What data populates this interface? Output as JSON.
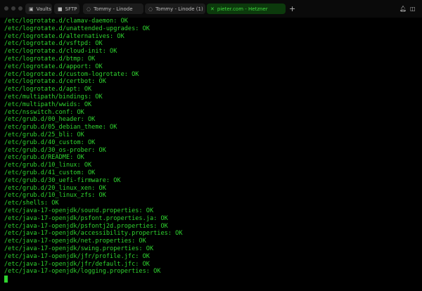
{
  "tabs": [
    {
      "label": "Vaults",
      "icon": "vault-icon"
    },
    {
      "label": "SFTP",
      "icon": "folder-icon"
    },
    {
      "label": "Tommy - Linode",
      "icon": "terminal-icon"
    },
    {
      "label": "Tommy - Linode (1)",
      "icon": "terminal-icon"
    },
    {
      "label": "pieter.com - Hetzner",
      "icon": "close-icon",
      "active": true
    }
  ],
  "new_tab": "+",
  "colors": {
    "terminal_text": "#2fd42f",
    "active_tab_bg": "#0c3a0c"
  },
  "terminal_lines": [
    "/etc/logrotate.d/clamav-daemon: OK",
    "/etc/logrotate.d/unattended-upgrades: OK",
    "/etc/logrotate.d/alternatives: OK",
    "/etc/logrotate.d/vsftpd: OK",
    "/etc/logrotate.d/cloud-init: OK",
    "/etc/logrotate.d/btmp: OK",
    "/etc/logrotate.d/apport: OK",
    "/etc/logrotate.d/custom-logrotate: OK",
    "/etc/logrotate.d/certbot: OK",
    "/etc/logrotate.d/apt: OK",
    "/etc/multipath/bindings: OK",
    "/etc/multipath/wwids: OK",
    "/etc/nsswitch.conf: OK",
    "/etc/grub.d/00_header: OK",
    "/etc/grub.d/05_debian_theme: OK",
    "/etc/grub.d/25_bli: OK",
    "/etc/grub.d/40_custom: OK",
    "/etc/grub.d/30_os-prober: OK",
    "/etc/grub.d/README: OK",
    "/etc/grub.d/10_linux: OK",
    "/etc/grub.d/41_custom: OK",
    "/etc/grub.d/30_uefi-firmware: OK",
    "/etc/grub.d/20_linux_xen: OK",
    "/etc/grub.d/10_linux_zfs: OK",
    "/etc/shells: OK",
    "/etc/java-17-openjdk/sound.properties: OK",
    "/etc/java-17-openjdk/psfont.properties.ja: OK",
    "/etc/java-17-openjdk/psfontj2d.properties: OK",
    "/etc/java-17-openjdk/accessibility.properties: OK",
    "/etc/java-17-openjdk/net.properties: OK",
    "/etc/java-17-openjdk/swing.properties: OK",
    "/etc/java-17-openjdk/jfr/profile.jfc: OK",
    "/etc/java-17-openjdk/jfr/default.jfc: OK",
    "/etc/java-17-openjdk/logging.properties: OK"
  ]
}
